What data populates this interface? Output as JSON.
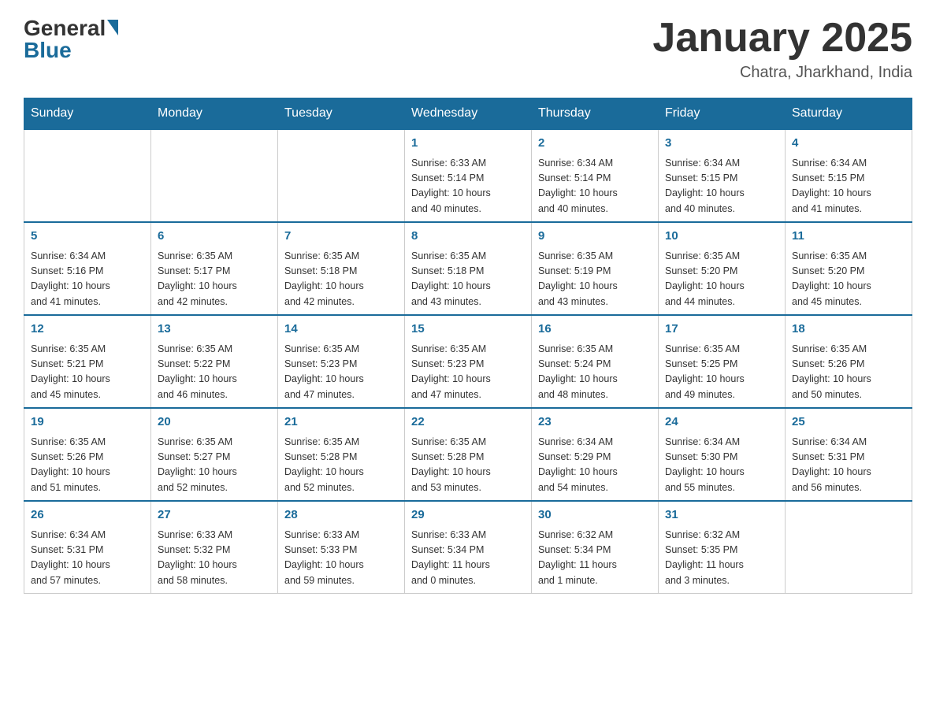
{
  "header": {
    "logo_general": "General",
    "logo_blue": "Blue",
    "title": "January 2025",
    "subtitle": "Chatra, Jharkhand, India"
  },
  "calendar": {
    "days_of_week": [
      "Sunday",
      "Monday",
      "Tuesday",
      "Wednesday",
      "Thursday",
      "Friday",
      "Saturday"
    ],
    "weeks": [
      [
        {
          "day": "",
          "info": ""
        },
        {
          "day": "",
          "info": ""
        },
        {
          "day": "",
          "info": ""
        },
        {
          "day": "1",
          "info": "Sunrise: 6:33 AM\nSunset: 5:14 PM\nDaylight: 10 hours\nand 40 minutes."
        },
        {
          "day": "2",
          "info": "Sunrise: 6:34 AM\nSunset: 5:14 PM\nDaylight: 10 hours\nand 40 minutes."
        },
        {
          "day": "3",
          "info": "Sunrise: 6:34 AM\nSunset: 5:15 PM\nDaylight: 10 hours\nand 40 minutes."
        },
        {
          "day": "4",
          "info": "Sunrise: 6:34 AM\nSunset: 5:15 PM\nDaylight: 10 hours\nand 41 minutes."
        }
      ],
      [
        {
          "day": "5",
          "info": "Sunrise: 6:34 AM\nSunset: 5:16 PM\nDaylight: 10 hours\nand 41 minutes."
        },
        {
          "day": "6",
          "info": "Sunrise: 6:35 AM\nSunset: 5:17 PM\nDaylight: 10 hours\nand 42 minutes."
        },
        {
          "day": "7",
          "info": "Sunrise: 6:35 AM\nSunset: 5:18 PM\nDaylight: 10 hours\nand 42 minutes."
        },
        {
          "day": "8",
          "info": "Sunrise: 6:35 AM\nSunset: 5:18 PM\nDaylight: 10 hours\nand 43 minutes."
        },
        {
          "day": "9",
          "info": "Sunrise: 6:35 AM\nSunset: 5:19 PM\nDaylight: 10 hours\nand 43 minutes."
        },
        {
          "day": "10",
          "info": "Sunrise: 6:35 AM\nSunset: 5:20 PM\nDaylight: 10 hours\nand 44 minutes."
        },
        {
          "day": "11",
          "info": "Sunrise: 6:35 AM\nSunset: 5:20 PM\nDaylight: 10 hours\nand 45 minutes."
        }
      ],
      [
        {
          "day": "12",
          "info": "Sunrise: 6:35 AM\nSunset: 5:21 PM\nDaylight: 10 hours\nand 45 minutes."
        },
        {
          "day": "13",
          "info": "Sunrise: 6:35 AM\nSunset: 5:22 PM\nDaylight: 10 hours\nand 46 minutes."
        },
        {
          "day": "14",
          "info": "Sunrise: 6:35 AM\nSunset: 5:23 PM\nDaylight: 10 hours\nand 47 minutes."
        },
        {
          "day": "15",
          "info": "Sunrise: 6:35 AM\nSunset: 5:23 PM\nDaylight: 10 hours\nand 47 minutes."
        },
        {
          "day": "16",
          "info": "Sunrise: 6:35 AM\nSunset: 5:24 PM\nDaylight: 10 hours\nand 48 minutes."
        },
        {
          "day": "17",
          "info": "Sunrise: 6:35 AM\nSunset: 5:25 PM\nDaylight: 10 hours\nand 49 minutes."
        },
        {
          "day": "18",
          "info": "Sunrise: 6:35 AM\nSunset: 5:26 PM\nDaylight: 10 hours\nand 50 minutes."
        }
      ],
      [
        {
          "day": "19",
          "info": "Sunrise: 6:35 AM\nSunset: 5:26 PM\nDaylight: 10 hours\nand 51 minutes."
        },
        {
          "day": "20",
          "info": "Sunrise: 6:35 AM\nSunset: 5:27 PM\nDaylight: 10 hours\nand 52 minutes."
        },
        {
          "day": "21",
          "info": "Sunrise: 6:35 AM\nSunset: 5:28 PM\nDaylight: 10 hours\nand 52 minutes."
        },
        {
          "day": "22",
          "info": "Sunrise: 6:35 AM\nSunset: 5:28 PM\nDaylight: 10 hours\nand 53 minutes."
        },
        {
          "day": "23",
          "info": "Sunrise: 6:34 AM\nSunset: 5:29 PM\nDaylight: 10 hours\nand 54 minutes."
        },
        {
          "day": "24",
          "info": "Sunrise: 6:34 AM\nSunset: 5:30 PM\nDaylight: 10 hours\nand 55 minutes."
        },
        {
          "day": "25",
          "info": "Sunrise: 6:34 AM\nSunset: 5:31 PM\nDaylight: 10 hours\nand 56 minutes."
        }
      ],
      [
        {
          "day": "26",
          "info": "Sunrise: 6:34 AM\nSunset: 5:31 PM\nDaylight: 10 hours\nand 57 minutes."
        },
        {
          "day": "27",
          "info": "Sunrise: 6:33 AM\nSunset: 5:32 PM\nDaylight: 10 hours\nand 58 minutes."
        },
        {
          "day": "28",
          "info": "Sunrise: 6:33 AM\nSunset: 5:33 PM\nDaylight: 10 hours\nand 59 minutes."
        },
        {
          "day": "29",
          "info": "Sunrise: 6:33 AM\nSunset: 5:34 PM\nDaylight: 11 hours\nand 0 minutes."
        },
        {
          "day": "30",
          "info": "Sunrise: 6:32 AM\nSunset: 5:34 PM\nDaylight: 11 hours\nand 1 minute."
        },
        {
          "day": "31",
          "info": "Sunrise: 6:32 AM\nSunset: 5:35 PM\nDaylight: 11 hours\nand 3 minutes."
        },
        {
          "day": "",
          "info": ""
        }
      ]
    ]
  }
}
